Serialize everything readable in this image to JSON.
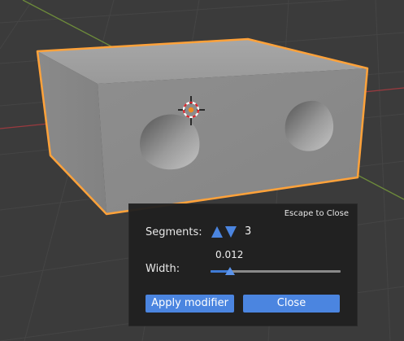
{
  "colors": {
    "viewport_bg": "#3b3b3b",
    "grid_line": "#454545",
    "x_axis": "#9b3a3f",
    "y_axis": "#6d8b3b",
    "selection_outline": "#ffa23a",
    "accent_blue": "#4b85e0"
  },
  "icons": {
    "segments_up": "up-triangle",
    "segments_down": "down-triangle",
    "cursor": "3d-cursor-crosshair"
  },
  "panel": {
    "escape_hint": "Escape to Close",
    "segments_label": "Segments:",
    "segments_value": "3",
    "width_label": "Width:",
    "width_value": "0.012",
    "width_slider_fraction": 0.15,
    "apply_label": "Apply modifier",
    "close_label": "Close"
  }
}
